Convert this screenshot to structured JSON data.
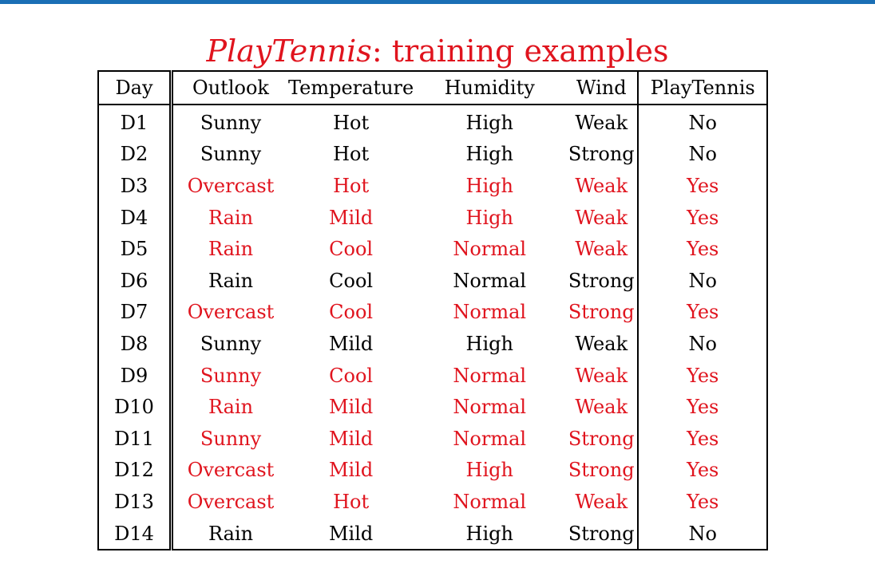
{
  "colors": {
    "accent": "#1a6fb5",
    "highlight": "#e0141e",
    "text": "#000000"
  },
  "title": {
    "italic": "PlayTennis",
    "rest": ": training examples"
  },
  "table": {
    "headers": [
      "Day",
      "Outlook",
      "Temperature",
      "Humidity",
      "Wind",
      "PlayTennis"
    ],
    "rows": [
      {
        "day": "D1",
        "outlook": "Sunny",
        "temperature": "Hot",
        "humidity": "High",
        "wind": "Weak",
        "play": "No",
        "highlight": false
      },
      {
        "day": "D2",
        "outlook": "Sunny",
        "temperature": "Hot",
        "humidity": "High",
        "wind": "Strong",
        "play": "No",
        "highlight": false
      },
      {
        "day": "D3",
        "outlook": "Overcast",
        "temperature": "Hot",
        "humidity": "High",
        "wind": "Weak",
        "play": "Yes",
        "highlight": true
      },
      {
        "day": "D4",
        "outlook": "Rain",
        "temperature": "Mild",
        "humidity": "High",
        "wind": "Weak",
        "play": "Yes",
        "highlight": true
      },
      {
        "day": "D5",
        "outlook": "Rain",
        "temperature": "Cool",
        "humidity": "Normal",
        "wind": "Weak",
        "play": "Yes",
        "highlight": true
      },
      {
        "day": "D6",
        "outlook": "Rain",
        "temperature": "Cool",
        "humidity": "Normal",
        "wind": "Strong",
        "play": "No",
        "highlight": false
      },
      {
        "day": "D7",
        "outlook": "Overcast",
        "temperature": "Cool",
        "humidity": "Normal",
        "wind": "Strong",
        "play": "Yes",
        "highlight": true
      },
      {
        "day": "D8",
        "outlook": "Sunny",
        "temperature": "Mild",
        "humidity": "High",
        "wind": "Weak",
        "play": "No",
        "highlight": false
      },
      {
        "day": "D9",
        "outlook": "Sunny",
        "temperature": "Cool",
        "humidity": "Normal",
        "wind": "Weak",
        "play": "Yes",
        "highlight": true
      },
      {
        "day": "D10",
        "outlook": "Rain",
        "temperature": "Mild",
        "humidity": "Normal",
        "wind": "Weak",
        "play": "Yes",
        "highlight": true
      },
      {
        "day": "D11",
        "outlook": "Sunny",
        "temperature": "Mild",
        "humidity": "Normal",
        "wind": "Strong",
        "play": "Yes",
        "highlight": true
      },
      {
        "day": "D12",
        "outlook": "Overcast",
        "temperature": "Mild",
        "humidity": "High",
        "wind": "Strong",
        "play": "Yes",
        "highlight": true
      },
      {
        "day": "D13",
        "outlook": "Overcast",
        "temperature": "Hot",
        "humidity": "Normal",
        "wind": "Weak",
        "play": "Yes",
        "highlight": true
      },
      {
        "day": "D14",
        "outlook": "Rain",
        "temperature": "Mild",
        "humidity": "High",
        "wind": "Strong",
        "play": "No",
        "highlight": false
      }
    ]
  }
}
